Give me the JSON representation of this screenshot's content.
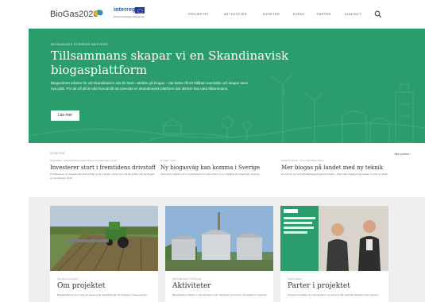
{
  "brand": {
    "name": "BioGas2020",
    "partner_logo": "interreg",
    "partner_sub": "Öresund-Kattegat-Skagerrak",
    "colors": {
      "hero_green": "#2b9c6b",
      "nav_text": "#555555",
      "accent_blue": "#1f4fa0"
    }
  },
  "nav": {
    "items": [
      "PROJEKTET",
      "AKTIVITETER",
      "NYHETER",
      "EVENT",
      "PARTER",
      "KONTAKT"
    ],
    "search_icon": "search-icon"
  },
  "hero": {
    "kicker": "BIOGAS2020 STÄRKER NÄTVERK",
    "title": "Tillsammans skapar vi en Skandinavisk biogasplattform",
    "text": "Biogas2020 arbetar för att Skandinavien ska bli bäst i världen på biogas – det bidrar till ett hållbart samhälle och skapar även nya jobb. För att nå dit är vårt huvudmål att utveckla en skandinavisk plattform där aktörer kan vara tillsammans.",
    "button": "Läs mer"
  },
  "news": {
    "label": "NYHETER",
    "all_link": "Alla nyheter ›",
    "items": [
      {
        "kicker": "SVERIGE: VÄRLDSLEDANDE BIOGASMARKNAD 2016",
        "title": "Investerer stort i fremtidens drivstoff",
        "text": "Produksjonen av biogass skal økes kraftig og flere aktører satser stort på drivstoffet. Nå planlegges en storsatsing i 2016."
      },
      {
        "kicker": "NYHET: 2017",
        "title": "Ny biogasväg kan komma i Sverige",
        "text": "Flera större aktörer har nu samarbetat och undersöker en ny möjlighet för biogasväg i Sverige."
      },
      {
        "kicker": "FÖRTÄTNING: PÅ LANDSBYGDEN",
        "title": "Mer biogas på landet med ny teknik",
        "text": "Nu ska de nya små gårdsanläggningarna bli bättre – flera olika anläggningar testas nu med ny teknik."
      }
    ]
  },
  "cards": [
    {
      "kicker": "OM BIOGAS2020",
      "title": "Om projektet",
      "text": "Biogas2020 har som syfte att skapa goda förutsättningar för biogasen i hela regionen."
    },
    {
      "kicker": "PROJEKTAKTIVITETER",
      "title": "Aktiviteter",
      "text": "Biogas2020 omfattar en rad aktiviteter inom näringsliv, kommuner och akademi i regionen."
    },
    {
      "kicker": "PARTNERS",
      "title": "Parter i projektet",
      "text": "Projektet innefattar ett brett spektrum av partners från hela Skandinavien och regionen."
    }
  ]
}
